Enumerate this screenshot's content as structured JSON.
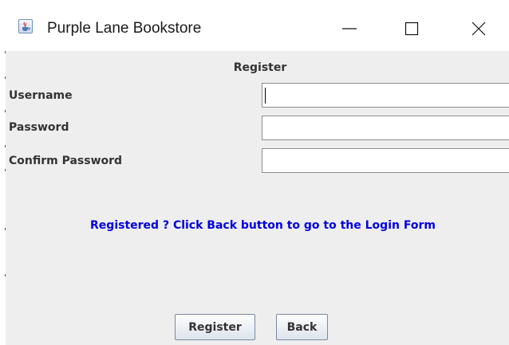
{
  "window": {
    "title": "Purple Lane Bookstore",
    "icon": "java-cup-icon",
    "controls": [
      "minimize-icon",
      "maximize-icon",
      "close-icon"
    ]
  },
  "form": {
    "heading": "Register",
    "fields": [
      {
        "label": "Username",
        "value": "",
        "focused": true
      },
      {
        "label": "Password",
        "value": ""
      },
      {
        "label": "Confirm Password",
        "value": ""
      }
    ],
    "info_text": "Registered ? Click Back button to go to the Login Form",
    "info_color": "#0000e0"
  },
  "buttons": {
    "register_label": "Register",
    "back_label": "Back"
  }
}
